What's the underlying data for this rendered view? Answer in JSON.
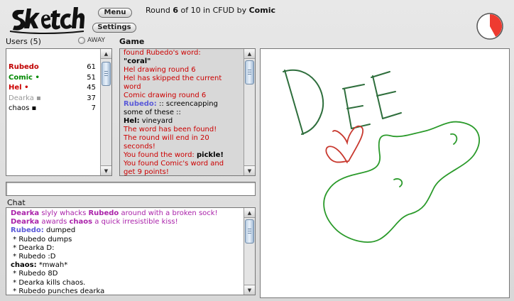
{
  "header": {
    "logo_text": "Sketch",
    "menu_label": "Menu",
    "settings_label": "Settings",
    "round_prefix": "Round ",
    "round_current": "6",
    "round_of": " of 10 in CFUD by ",
    "round_author": "Comic",
    "timer_elapsed_fraction": 0.42
  },
  "users_panel": {
    "title": "Users (5)",
    "away_label": "AWAY",
    "users": [
      {
        "name": "Rubedo",
        "mark": "",
        "score": "61",
        "color": "#c00000",
        "bold": true
      },
      {
        "name": "Comic",
        "mark": " •",
        "score": "51",
        "color": "#008800",
        "bold": true
      },
      {
        "name": "Hel",
        "mark": " •",
        "score": "45",
        "color": "#cc0000",
        "bold": true
      },
      {
        "name": "Dearka",
        "mark": " ▪",
        "score": "37",
        "color": "#999999",
        "bold": false
      },
      {
        "name": "chaos",
        "mark": " ▪",
        "score": "7",
        "color": "#000000",
        "bold": false
      }
    ]
  },
  "game_panel": {
    "title": "Game",
    "lines": [
      {
        "parts": [
          {
            "t": "found Rubedo's word:",
            "c": "#cc0000"
          }
        ]
      },
      {
        "parts": [
          {
            "t": "\"coral\"",
            "c": "#000000",
            "b": true
          }
        ]
      },
      {
        "parts": [
          {
            "t": "Hel drawing round 6",
            "c": "#cc0000"
          }
        ]
      },
      {
        "parts": [
          {
            "t": "Hel has skipped the current",
            "c": "#cc0000"
          }
        ]
      },
      {
        "parts": [
          {
            "t": "word",
            "c": "#cc0000"
          }
        ]
      },
      {
        "parts": [
          {
            "t": "Comic drawing round 6",
            "c": "#cc0000"
          }
        ]
      },
      {
        "parts": [
          {
            "t": "Rubedo:",
            "c": "#5a5ad8",
            "b": true
          },
          {
            "t": " :: screencapping",
            "c": "#000000"
          }
        ]
      },
      {
        "parts": [
          {
            "t": "some of these ::",
            "c": "#000000"
          }
        ]
      },
      {
        "parts": [
          {
            "t": "Hel:",
            "c": "#000000",
            "b": true
          },
          {
            "t": " vineyard",
            "c": "#000000"
          }
        ]
      },
      {
        "parts": [
          {
            "t": "The word has been found!",
            "c": "#cc0000"
          }
        ]
      },
      {
        "parts": [
          {
            "t": "The round will end in 20",
            "c": "#cc0000"
          }
        ]
      },
      {
        "parts": [
          {
            "t": "seconds!",
            "c": "#cc0000"
          }
        ]
      },
      {
        "parts": [
          {
            "t": "You found the word: ",
            "c": "#cc0000"
          },
          {
            "t": "pickle!",
            "c": "#000000",
            "b": true
          }
        ]
      },
      {
        "parts": [
          {
            "t": "You found Comic's word and",
            "c": "#cc0000"
          }
        ]
      },
      {
        "parts": [
          {
            "t": "get 9 points!",
            "c": "#cc0000"
          }
        ]
      }
    ]
  },
  "chat_input": {
    "value": "",
    "placeholder": ""
  },
  "chat_panel": {
    "title": "Chat",
    "lines": [
      {
        "parts": [
          {
            "t": "Dearka",
            "c": "#aa22aa",
            "b": true
          },
          {
            "t": " slyly whacks ",
            "c": "#aa22aa"
          },
          {
            "t": "Rubedo",
            "c": "#aa22aa",
            "b": true
          },
          {
            "t": " around with a broken sock!",
            "c": "#aa22aa"
          }
        ]
      },
      {
        "parts": [
          {
            "t": "Dearka",
            "c": "#aa22aa",
            "b": true
          },
          {
            "t": " awards ",
            "c": "#aa22aa"
          },
          {
            "t": "chaos",
            "c": "#aa22aa",
            "b": true
          },
          {
            "t": " a quick irresistible kiss!",
            "c": "#aa22aa"
          }
        ]
      },
      {
        "parts": [
          {
            "t": "Rubedo:",
            "c": "#5a5ad8",
            "b": true
          },
          {
            "t": " dumped",
            "c": "#000000"
          }
        ]
      },
      {
        "parts": [
          {
            "t": " * Rubedo dumps",
            "c": "#000000"
          }
        ]
      },
      {
        "parts": [
          {
            "t": " * Dearka D:",
            "c": "#000000"
          }
        ]
      },
      {
        "parts": [
          {
            "t": " * Rubedo :D",
            "c": "#000000"
          }
        ]
      },
      {
        "parts": [
          {
            "t": "chaos:",
            "c": "#000000",
            "b": true
          },
          {
            "t": " *mwah*",
            "c": "#000000"
          }
        ]
      },
      {
        "parts": [
          {
            "t": " * Rubedo 8D",
            "c": "#000000"
          }
        ]
      },
      {
        "parts": [
          {
            "t": " * Dearka kills chaos.",
            "c": "#000000"
          }
        ]
      },
      {
        "parts": [
          {
            "t": " * Rubedo punches dearka",
            "c": "#000000"
          }
        ]
      }
    ]
  },
  "drawing": {
    "ink_colors": {
      "letters": "#2e6e3c",
      "heart": "#c8382e",
      "pickle": "#2a9a2a"
    },
    "letters_text": "DEE"
  }
}
